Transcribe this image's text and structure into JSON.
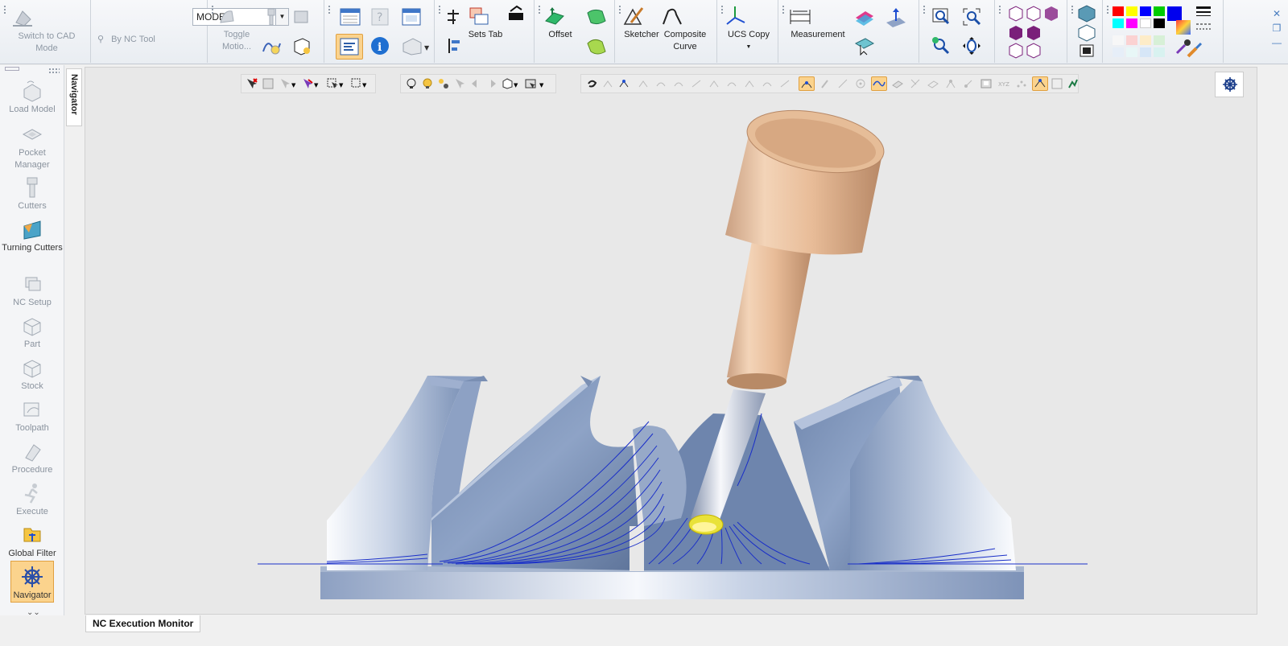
{
  "ribbon": {
    "switch_cad": "Switch to CAD Mode",
    "model_select": "MODEL",
    "by_nc_tool": "By NC Tool",
    "toggle_motion": "Toggle Motio...",
    "sets_tab": "Sets Tab",
    "offset": "Offset",
    "sketcher": "Sketcher",
    "composite_curve": "Composite Curve",
    "ucs_copy": "UCS Copy",
    "measurement": "Measurement"
  },
  "navigator": {
    "tab_label": "Navigator",
    "items": [
      {
        "label": "Load Model"
      },
      {
        "label": "Pocket Manager"
      },
      {
        "label": "Cutters"
      },
      {
        "label": "Turning Cutters"
      },
      {
        "label": "NC Setup"
      },
      {
        "label": "Part"
      },
      {
        "label": "Stock"
      },
      {
        "label": "Toolpath"
      },
      {
        "label": "Procedure"
      },
      {
        "label": "Execute"
      },
      {
        "label": "Global Filter"
      },
      {
        "label": "Navigator"
      }
    ]
  },
  "bottom": {
    "nc_execution_monitor": "NC Execution Monitor"
  },
  "palette": [
    "#ff0000",
    "#ffff00",
    "#0000ff",
    "#00cc00",
    "#0000ee",
    "#00ffff",
    "#ff00ff",
    "#ffffff",
    "#000000"
  ],
  "colors": {
    "accent_selected": "#fbd38d",
    "toolpath": "#1a2fc8",
    "part_blue": "#8fa6c8",
    "tool_copper": "#d9a783"
  }
}
